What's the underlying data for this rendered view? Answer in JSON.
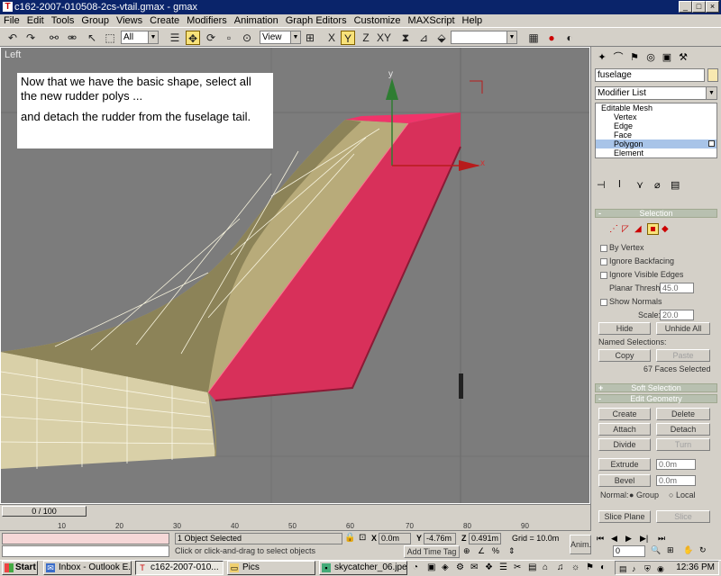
{
  "window": {
    "title": "c162-2007-010508-2cs-vtail.gmax - gmax"
  },
  "menu": [
    "File",
    "Edit",
    "Tools",
    "Group",
    "Views",
    "Create",
    "Modifiers",
    "Animation",
    "Graph Editors",
    "Customize",
    "MAXScript",
    "Help"
  ],
  "toolbar": {
    "selection_filter": "All",
    "ref_coord": "View"
  },
  "viewport": {
    "label": "Left",
    "axis_y": "y",
    "axis_x": "x",
    "tutorial_line1": "Now that we have the basic shape, select all the new rudder polys ...",
    "tutorial_line2": "and detach the rudder from the fuselage tail."
  },
  "panel": {
    "object_name": "fuselage",
    "modifier_list": "Modifier List",
    "stack": {
      "root": "Editable Mesh",
      "items": [
        "Vertex",
        "Edge",
        "Face",
        "Polygon",
        "Element"
      ],
      "selected": "Polygon"
    },
    "selection_rollout": {
      "title": "Selection",
      "by_vertex": "By Vertex",
      "ignore_backfacing": "Ignore Backfacing",
      "ignore_visible_edges": "Ignore Visible Edges",
      "planar_thresh_label": "Planar Thresh:",
      "planar_thresh_value": "45.0",
      "show_normals": "Show Normals",
      "scale_label": "Scale:",
      "scale_value": "20.0",
      "hide": "Hide",
      "unhide_all": "Unhide All",
      "named_selections": "Named Selections:",
      "copy": "Copy",
      "paste": "Paste",
      "selected_count": "67 Faces Selected"
    },
    "soft_selection": "Soft Selection",
    "edit_geometry": {
      "title": "Edit Geometry",
      "create": "Create",
      "delete": "Delete",
      "attach": "Attach",
      "detach": "Detach",
      "divide": "Divide",
      "turn": "Turn",
      "extrude": "Extrude",
      "extrude_value": "0.0m",
      "bevel": "Bevel",
      "bevel_value": "0.0m",
      "normal_label": "Normal:",
      "group": "Group",
      "local": "Local",
      "slice_plane": "Slice Plane",
      "slice": "Slice"
    }
  },
  "timeline": {
    "frame": "0 / 100",
    "ticks": [
      "10",
      "20",
      "30",
      "40",
      "50",
      "60",
      "70",
      "80",
      "90"
    ]
  },
  "status": {
    "objects_selected": "1 Object Selected",
    "prompt": "Click or click-and-drag to select objects",
    "x_label": "X",
    "x_value": "0.0m",
    "y_label": "Y",
    "y_value": "-4.76m",
    "z_label": "Z",
    "z_value": "0.491m",
    "grid": "Grid = 10.0m",
    "add_time_tag": "Add Time Tag",
    "anim": "Anim.",
    "frame_field": "0"
  },
  "taskbar": {
    "start": "Start",
    "tasks": [
      "Inbox - Outlook E...",
      "c162-2007-010...",
      "Pics",
      "skycatcher_06.jpe..."
    ],
    "active_task": "c162-2007-010...",
    "clock": "12:36 PM"
  },
  "colors": {
    "rudder": "#d8305a",
    "fin": "#b8ab7a",
    "viewport_bg": "#7c7c7c",
    "titlebar": "#0a246a"
  }
}
